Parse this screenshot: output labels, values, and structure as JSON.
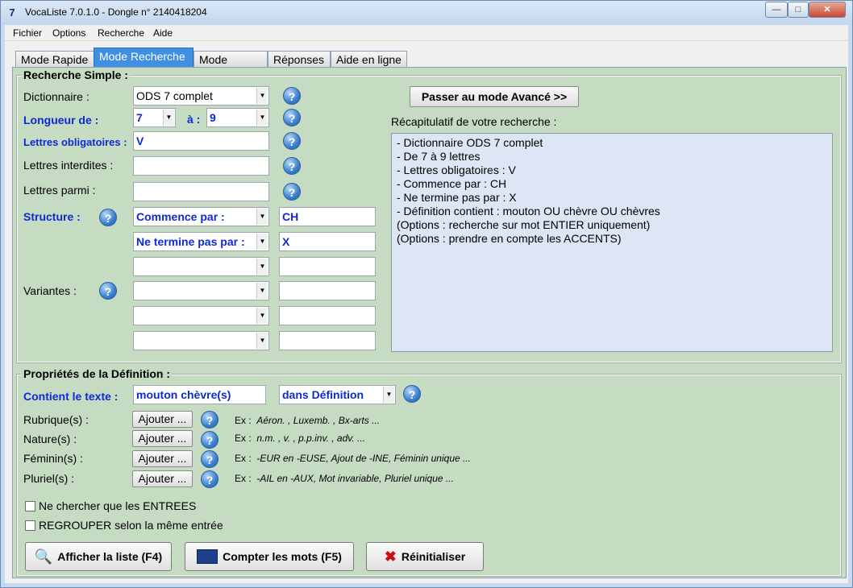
{
  "window": {
    "title": "VocaListe 7.0.1.0 - Dongle n° 2140418204",
    "icon_glyph": "7",
    "minimize": "—",
    "maximize": "□",
    "close": "✕"
  },
  "menu": [
    "Fichier",
    "Options",
    "Recherche",
    "Aide"
  ],
  "tabs": [
    "Mode Rapide",
    "Mode Recherche",
    "Mode Expert",
    "Réponses",
    "Aide en ligne"
  ],
  "active_tab": "Mode Recherche",
  "simple": {
    "title": "Recherche Simple :",
    "dictionnaire_label": "Dictionnaire :",
    "dictionnaire_value": "ODS 7 complet",
    "longueur_label": "Longueur de :",
    "longueur_from": "7",
    "longueur_to_label": "à :",
    "longueur_to": "9",
    "obligatoires_label": "Lettres obligatoires :",
    "obligatoires_value": "V",
    "interdites_label": "Lettres interdites :",
    "interdites_value": "",
    "parmi_label": "Lettres parmi :",
    "parmi_value": "",
    "structure_label": "Structure :",
    "structure_rows": [
      {
        "mode": "Commence par :",
        "value": "CH"
      },
      {
        "mode": "Ne termine pas par :",
        "value": "X"
      }
    ],
    "variantes_label": "Variantes :",
    "advanced_button": "Passer au mode Avancé >>",
    "recap_label": "Récapitulatif de votre recherche :",
    "recap_lines": [
      "- Dictionnaire ODS 7 complet",
      "- De 7 à 9 lettres",
      "- Lettres obligatoires : V",
      "- Commence par : CH",
      "- Ne termine pas par : X",
      "- Définition contient : mouton OU chèvre OU chèvres",
      "(Options : recherche sur mot ENTIER uniquement)",
      "(Options : prendre en compte les ACCENTS)"
    ]
  },
  "definition": {
    "title": "Propriétés de la Définition :",
    "contient_label": "Contient le texte :",
    "contient_value": "mouton chèvre(s)",
    "scope_value": "dans Définition",
    "rows": [
      {
        "label": "Rubrique(s) :",
        "button": "Ajouter ...",
        "prefix": "Ex :",
        "example": "Aéron. , Luxemb. , Bx-arts ..."
      },
      {
        "label": "Nature(s) :",
        "button": "Ajouter ...",
        "prefix": "Ex :",
        "example": "n.m. , v. , p.p.inv. , adv. ..."
      },
      {
        "label": "Féminin(s) :",
        "button": "Ajouter ...",
        "prefix": "Ex :",
        "example": "-EUR en -EUSE, Ajout de -INE, Féminin unique ..."
      },
      {
        "label": "Pluriel(s) :",
        "button": "Ajouter ...",
        "prefix": "Ex :",
        "example": "-AIL en -AUX, Mot invariable, Pluriel unique ..."
      }
    ],
    "check_entrees": "Ne chercher que les ENTREES",
    "check_regrouper": "REGROUPER selon la même entrée"
  },
  "actions": {
    "afficher": "Afficher la liste (F4)",
    "compter": "Compter les mots (F5)",
    "reinit": "Réinitialiser"
  },
  "icons": {
    "help": "?",
    "dropdown": "▼",
    "afficher_icon": "magnifier-icon",
    "compter_icon": "calculator-icon",
    "reinit_icon": "red-x-icon"
  },
  "colors": {
    "panel_bg": "#c5dcc3",
    "accent_blue": "#0e2ad4",
    "active_tab": "#3f8fe2",
    "summary_bg": "#dde6f4"
  }
}
